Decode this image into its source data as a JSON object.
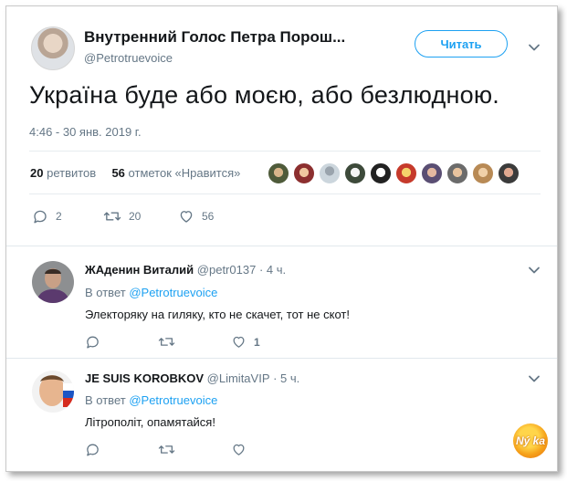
{
  "tweet": {
    "author_name": "Внутренний Голос Петра Порош...",
    "author_handle": "@Petrotruevoice",
    "follow_label": "Читать",
    "text": "Україна буде або моєю, або безлюдною.",
    "timestamp": "4:46 - 30 янв. 2019 г.",
    "retweets_count": "20",
    "retweets_label": "ретвитов",
    "likes_count": "56",
    "likes_label": "отметок «Нравится»",
    "actions": {
      "replies": "2",
      "retweets": "20",
      "likes": "56"
    }
  },
  "replies": [
    {
      "name": "ЖАденин Виталий",
      "handle": "@petr0137",
      "time": "· 4 ч.",
      "in_reply_prefix": "В ответ",
      "in_reply_handle": "@Petrotruevoice",
      "text": "Электоряку на гиляку, кто не скачет, тот не скот!",
      "likes": "1"
    },
    {
      "name": "JE SUIS KOROBKOV",
      "handle": "@LimitaVIP",
      "time": "· 5 ч.",
      "in_reply_prefix": "В ответ",
      "in_reply_handle": "@Petrotruevoice",
      "text": "Літрополіт, опамятайся!",
      "likes": ""
    }
  ],
  "watermark": {
    "text": "Ný ka"
  },
  "colors": {
    "accent": "#1da1f2",
    "muted": "#657786",
    "text": "#14171a",
    "divider": "#e6ecf0"
  }
}
